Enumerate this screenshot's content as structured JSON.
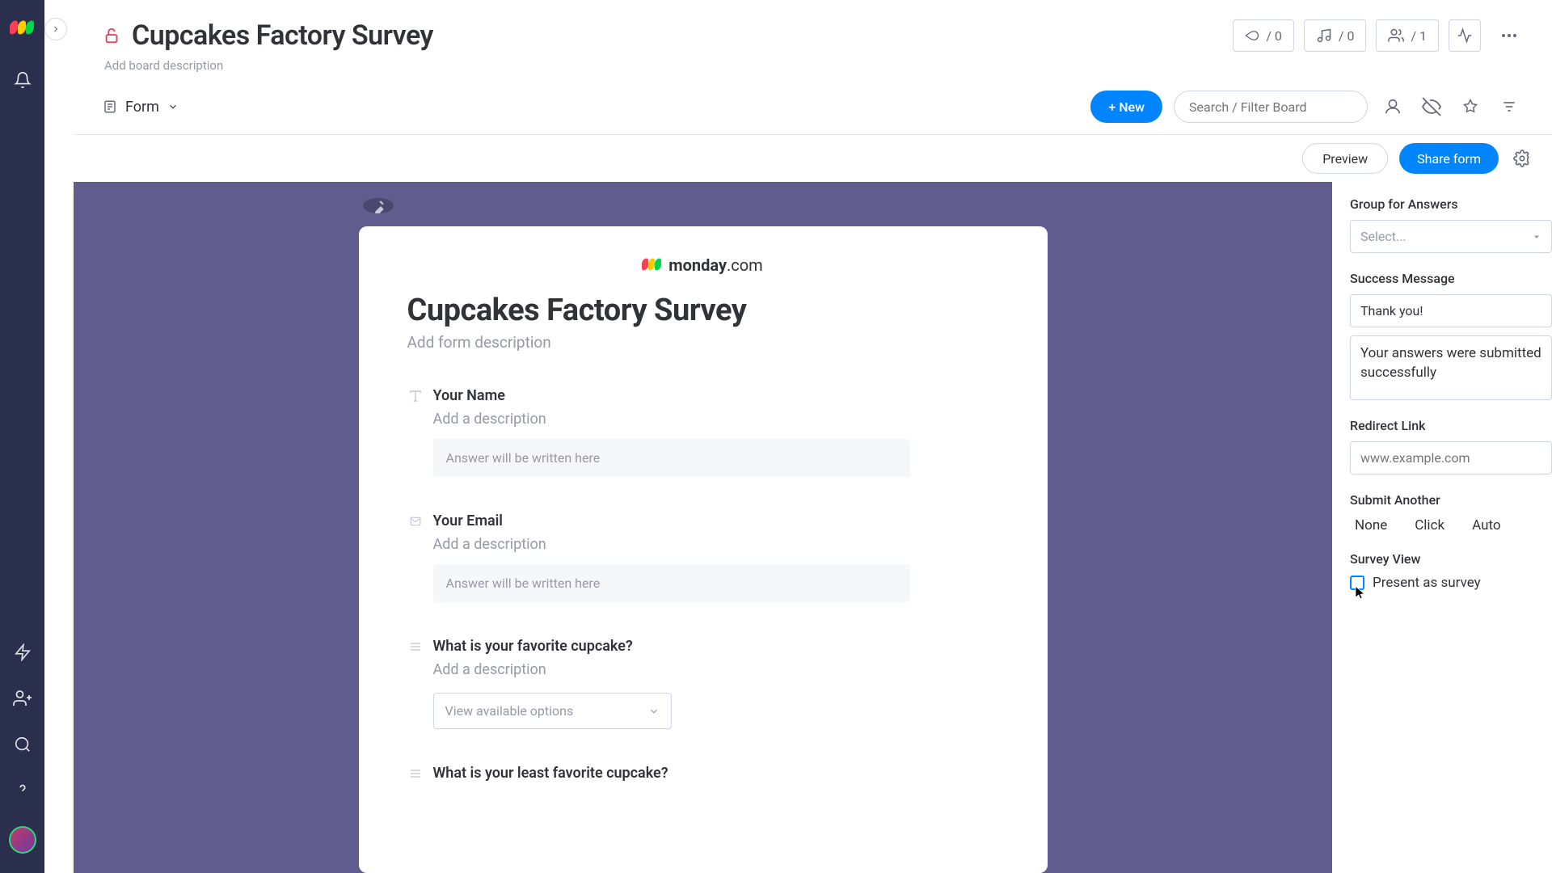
{
  "board": {
    "title": "Cupcakes Factory Survey",
    "description_placeholder": "Add board description"
  },
  "header": {
    "automations_count": "/ 0",
    "integrations_count": "/ 0",
    "members_count": "/ 1"
  },
  "viewbar": {
    "view_label": "Form",
    "new_button": "+ New",
    "search_placeholder": "Search / Filter Board"
  },
  "actionbar": {
    "preview": "Preview",
    "share": "Share form"
  },
  "form": {
    "logo_text": "monday",
    "logo_suffix": ".com",
    "title": "Cupcakes Factory Survey",
    "subtitle": "Add form description",
    "answer_placeholder": "Answer will be written here",
    "desc_placeholder": "Add a description",
    "dropdown_placeholder": "View available options",
    "questions": [
      {
        "title": "Your Name",
        "type": "text"
      },
      {
        "title": "Your Email",
        "type": "email"
      },
      {
        "title": "What is your favorite cupcake?",
        "type": "dropdown"
      },
      {
        "title": "What is your least favorite cupcake?",
        "type": "dropdown"
      }
    ]
  },
  "panel": {
    "group_label": "Group for Answers",
    "group_placeholder": "Select...",
    "success_label": "Success Message",
    "success_title": "Thank you!",
    "success_body": "Your answers were submitted successfully",
    "redirect_label": "Redirect Link",
    "redirect_placeholder": "www.example.com",
    "submit_label": "Submit Another",
    "submit_options": [
      "None",
      "Click",
      "Auto"
    ],
    "survey_label": "Survey View",
    "survey_checkbox": "Present as survey"
  }
}
